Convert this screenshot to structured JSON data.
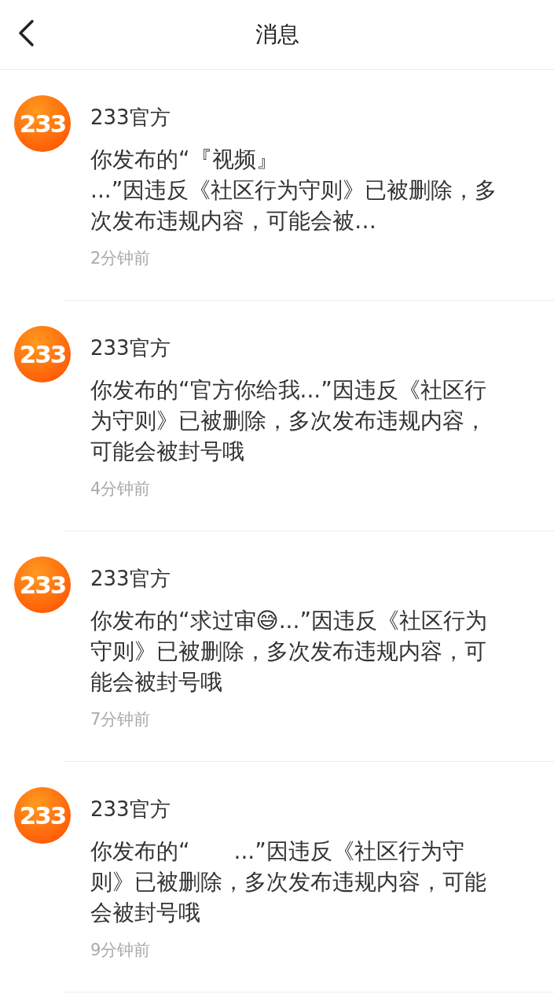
{
  "header": {
    "title": "消息"
  },
  "messages": [
    {
      "avatar_text": "233",
      "sender": "233官方",
      "body": "你发布的“『视频』\n...”因违反《社区行为守则》已被删除，多次发布违规内容，可能会被…",
      "time": "2分钟前"
    },
    {
      "avatar_text": "233",
      "sender": "233官方",
      "body": "你发布的“官方你给我...”因违反《社区行为守则》已被删除，多次发布违规内容，可能会被封号哦",
      "time": "4分钟前"
    },
    {
      "avatar_text": "233",
      "sender": "233官方",
      "body": "你发布的“求过审😅...”因违反《社区行为守则》已被删除，多次发布违规内容，可能会被封号哦",
      "time": "7分钟前"
    },
    {
      "avatar_text": "233",
      "sender": "233官方",
      "body": "你发布的“　　...”因违反《社区行为守则》已被删除，多次发布违规内容，可能会被封号哦",
      "time": "9分钟前"
    }
  ]
}
